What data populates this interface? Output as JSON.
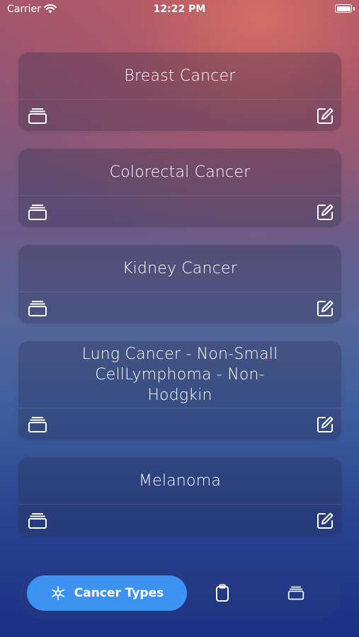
{
  "status_bar": {
    "carrier": "Carrier",
    "time": "12:22 PM"
  },
  "cards": [
    {
      "title": "Breast Cancer"
    },
    {
      "title": "Colorectal Cancer"
    },
    {
      "title": "Kidney Cancer"
    },
    {
      "title": "Lung Cancer - Non-Small CellLymphoma - Non-Hodgkin"
    },
    {
      "title": "Melanoma"
    }
  ],
  "tab_bar": {
    "active_label": "Cancer Types",
    "active_icon": "snowflake-icon",
    "tabs": [
      "clipboard-icon",
      "archive-box-icon"
    ],
    "accent_color": "#3d92f2"
  }
}
